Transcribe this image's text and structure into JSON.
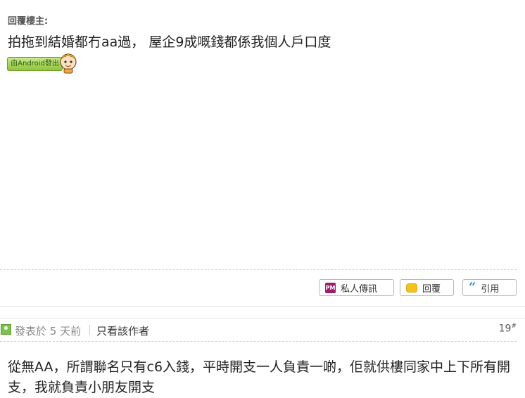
{
  "post_a": {
    "reply_label": "回覆樓主:",
    "body": "拍拖到結婚都冇aa過， 屋企9成嘅錢都係我個人戶口度",
    "badge_text": "由Android發出"
  },
  "actions": {
    "pm_icon": "PM",
    "pm_label": "私人傳訊",
    "reply_label": "回覆",
    "quote_label": "引用"
  },
  "post_b": {
    "posted": "發表於 5 天前",
    "only_author": "只看該作者",
    "floor": "19",
    "floor_mark": "#",
    "body": "從無AA，所謂聯名只有c6入錢，平時開支一人負責一啲，佢就供樓同家中上下所有開支，我就負責小朋友開支"
  },
  "colors": {
    "pm_icon": "#9b1f6e",
    "reply_icon": "#f4c21b",
    "quote_icon": "#3a8fd6",
    "user_icon": "#7cc24f"
  },
  "icons": [
    "pm-icon",
    "reply-bubble-icon",
    "quote-icon",
    "user-icon",
    "android-mascot-icon"
  ]
}
